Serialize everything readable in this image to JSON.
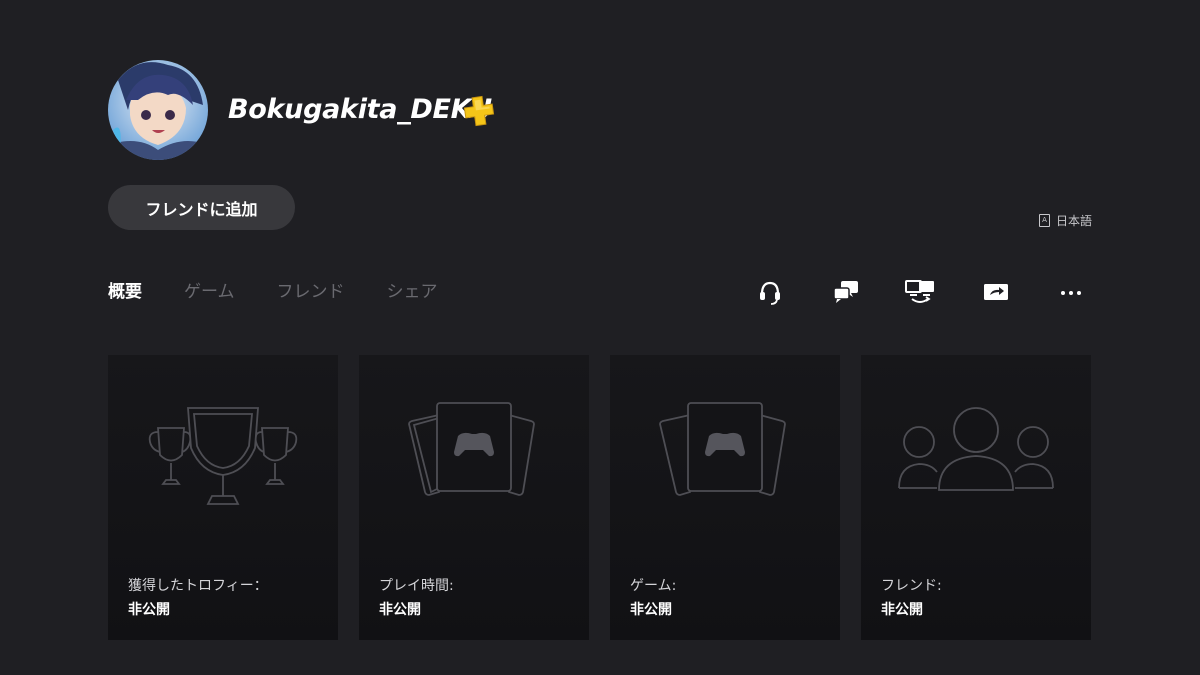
{
  "profile": {
    "username": "Bokugakita_DEKU",
    "add_friend_label": "フレンドに追加",
    "language": "日本語"
  },
  "tabs": [
    {
      "label": "概要",
      "active": true
    },
    {
      "label": "ゲーム",
      "active": false
    },
    {
      "label": "フレンド",
      "active": false
    },
    {
      "label": "シェア",
      "active": false
    }
  ],
  "actions": [
    "headset-icon",
    "chat-icon",
    "remote-play-icon",
    "share-screen-icon",
    "more-icon"
  ],
  "cards": [
    {
      "label": "獲得したトロフィー：",
      "value": "非公開",
      "icon": "trophies-icon"
    },
    {
      "label": "プレイ時間:",
      "value": "非公開",
      "icon": "game-cards-icon"
    },
    {
      "label": "ゲーム:",
      "value": "非公開",
      "icon": "game-cards-icon"
    },
    {
      "label": "フレンド:",
      "value": "非公開",
      "icon": "friends-icon"
    }
  ],
  "colors": {
    "background": "#1f1f23",
    "card": "#141417",
    "plus_gold": "#f5c518"
  }
}
